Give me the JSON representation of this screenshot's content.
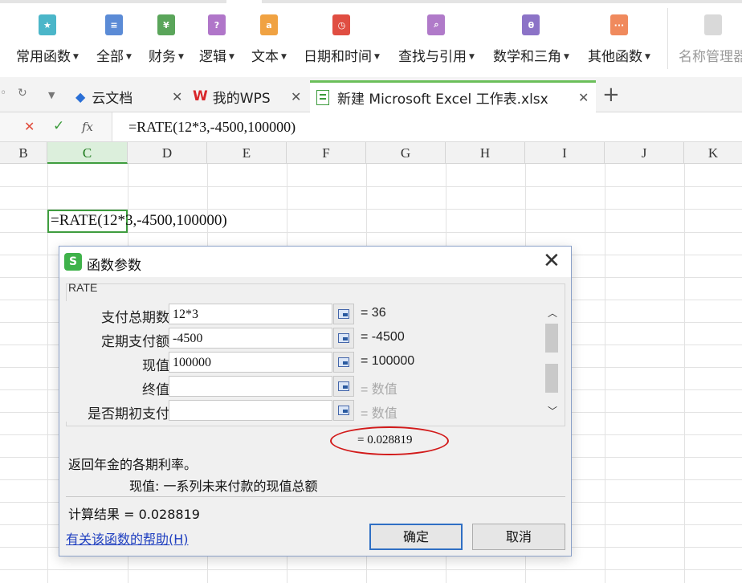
{
  "ribbon": {
    "items": [
      {
        "label": "常用函数",
        "icon": "star-function-icon",
        "color": "#4bb6c9"
      },
      {
        "label": "全部",
        "icon": "all-functions-icon",
        "color": "#5b8bd6"
      },
      {
        "label": "财务",
        "icon": "finance-icon",
        "color": "#5aa55a"
      },
      {
        "label": "逻辑",
        "icon": "logic-icon",
        "color": "#b076c9"
      },
      {
        "label": "文本",
        "icon": "text-icon",
        "color": "#f0a242"
      },
      {
        "label": "日期和时间",
        "icon": "clock-icon",
        "color": "#e04e42"
      },
      {
        "label": "查找与引用",
        "icon": "lookup-icon",
        "color": "#b07ac9"
      },
      {
        "label": "数学和三角",
        "icon": "math-icon",
        "color": "#8c73c7"
      },
      {
        "label": "其他函数",
        "icon": "more-functions-icon",
        "color": "#f08a5d"
      }
    ],
    "name_manager_label": "名称管理器"
  },
  "tabs": {
    "items": [
      {
        "label": "云文档",
        "icon": "cloud-doc-icon"
      },
      {
        "label": "我的WPS",
        "icon": "wps-logo-icon"
      },
      {
        "label": "新建 Microsoft Excel 工作表.xlsx",
        "icon": "excel-file-icon"
      }
    ],
    "new_tab_icon": "plus-icon"
  },
  "formula_bar": {
    "cancel_icon": "cancel-x-icon",
    "confirm_icon": "checkmark-icon",
    "fx_label": "fx",
    "formula": "=RATE(12*3,-4500,100000)"
  },
  "grid": {
    "columns": [
      "B",
      "C",
      "D",
      "E",
      "F",
      "G",
      "H",
      "I",
      "J",
      "K"
    ],
    "selected_column": "C",
    "active_cell_text": "=RATE(12*3,-4500,100000)"
  },
  "dialog": {
    "title": "函数参数",
    "function_name": "RATE",
    "args": [
      {
        "label": "支付总期数",
        "value": "12*3",
        "result": "= 36"
      },
      {
        "label": "定期支付额",
        "value": "-4500",
        "result": "= -4500"
      },
      {
        "label": "现值",
        "value": "100000",
        "result": "= 100000"
      },
      {
        "label": "终值",
        "value": "",
        "result": "= 数值"
      },
      {
        "label": "是否期初支付",
        "value": "",
        "result": "= 数值"
      }
    ],
    "result_line": "= 0.028819",
    "description": "返回年金的各期利率。",
    "arg_description": "现值: 一系列未来付款的现值总额",
    "calc_result": "计算结果 = 0.028819",
    "help_link": "有关该函数的帮助(H)",
    "ok_label": "确定",
    "cancel_label": "取消"
  }
}
